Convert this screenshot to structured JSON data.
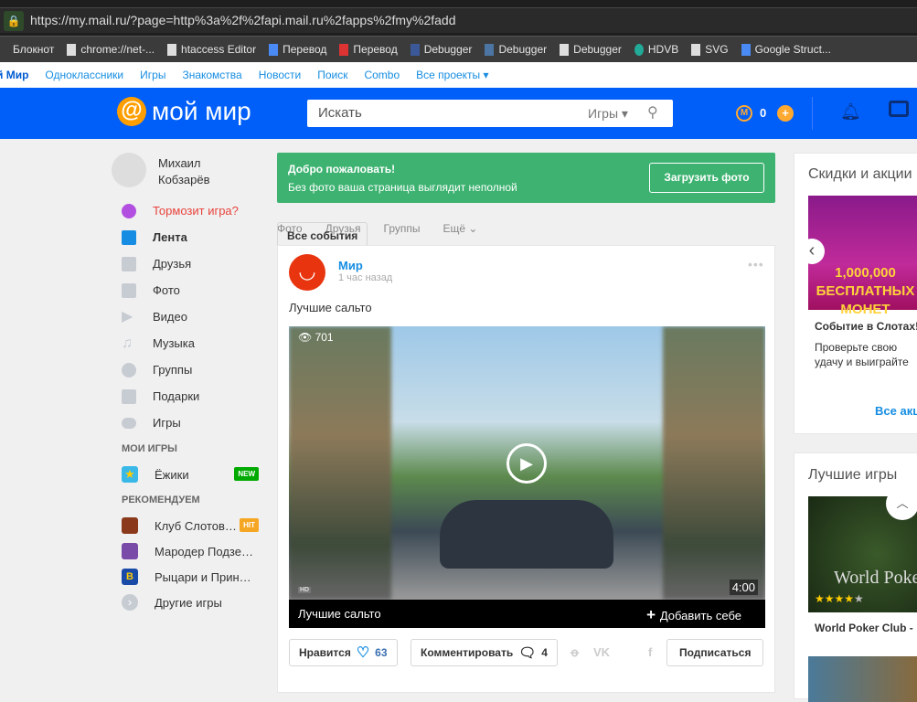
{
  "browser": {
    "url": "https://my.mail.ru/?page=http%3a%2f%2fapi.mail.ru%2fapps%2fmy%2fadd",
    "bookmarks": [
      "Блокнот",
      "chrome://net-...",
      "htaccess Editor",
      "Перевод",
      "Перевод",
      "Debugger",
      "Debugger",
      "Debugger",
      "HDVB",
      "SVG",
      "Google Struct..."
    ]
  },
  "topnav": [
    "й Мир",
    "Одноклассники",
    "Игры",
    "Знакомства",
    "Новости",
    "Поиск",
    "Combo",
    "Все проекты ▾"
  ],
  "header": {
    "logo": "мой мир",
    "search_placeholder": "Искать",
    "search_category": "Игры ▾",
    "coins": "0"
  },
  "sidebar": {
    "user": "Михаил Кобзарёв",
    "items": [
      {
        "label": "Тормозит игра?",
        "color": "#e8433c"
      },
      {
        "label": "Лента"
      },
      {
        "label": "Друзья"
      },
      {
        "label": "Фото"
      },
      {
        "label": "Видео"
      },
      {
        "label": "Музыка"
      },
      {
        "label": "Группы"
      },
      {
        "label": "Подарки"
      },
      {
        "label": "Игры"
      }
    ],
    "my_games_title": "МОИ ИГРЫ",
    "my_games": [
      {
        "label": "Ёжики",
        "badge": "NEW"
      }
    ],
    "recommend_title": "РЕКОМЕНДУЕМ",
    "recommend": [
      {
        "label": "Клуб Слотов…",
        "badge": "HIT"
      },
      {
        "label": "Мародер Подзе…"
      },
      {
        "label": "Рыцари и Прин…"
      },
      {
        "label": "Другие игры"
      }
    ]
  },
  "welcome": {
    "title": "Добро пожаловать!",
    "text": "Без фото ваша страница выглядит неполной",
    "button": "Загрузить фото"
  },
  "tabs": [
    "Все события",
    "Фото",
    "Друзья",
    "Группы",
    "Ещё ⌄"
  ],
  "post": {
    "author": "Мир",
    "time": "1 час назад",
    "text": "Лучшие сальто",
    "video": {
      "views": "701",
      "duration": "4:00",
      "hd": "HD",
      "title": "Лучшие сальто",
      "add": "Добавить себе"
    },
    "like_label": "Нравится",
    "likes": "63",
    "comment_label": "Комментировать",
    "comments": "4",
    "subscribe": "Подписаться"
  },
  "right": {
    "promo_title": "Скидки и акции",
    "promo_banner": "1,000,000 БЕСПЛАТНЫХ МОНЕТ",
    "promo_name": "Событие в Слотах!",
    "promo_text": "Проверьте свою удачу и выиграйте много монет",
    "promo_all": "Все акции",
    "games_title": "Лучшие игры",
    "game_name": "World Poker Club - ",
    "game_banner": "World Poker",
    "game_rating": 4
  }
}
